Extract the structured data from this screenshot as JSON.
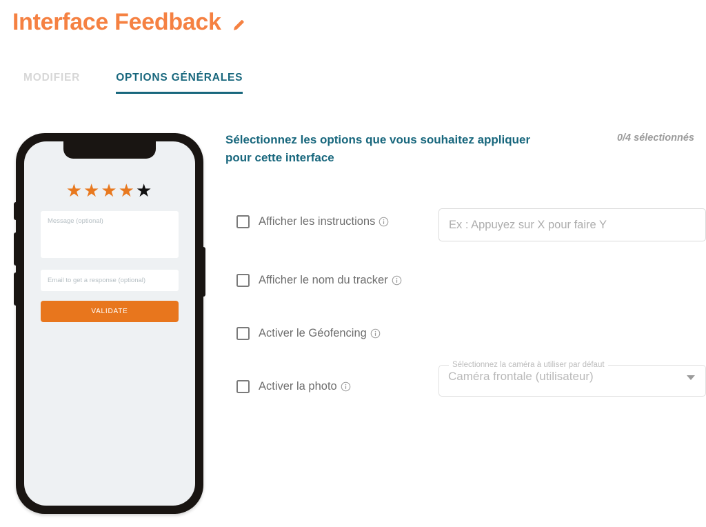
{
  "header": {
    "title": "Interface Feedback",
    "edit_icon": "pencil-icon",
    "title_color": "#f58142"
  },
  "tabs": [
    {
      "label": "MODIFIER",
      "active": false
    },
    {
      "label": "OPTIONS GÉNÉRALES",
      "active": true
    }
  ],
  "tab_active_color": "#18677d",
  "tab_inactive_color": "#d7d7d7",
  "phone_preview": {
    "rating": {
      "total": 5,
      "filled": 4,
      "filled_color": "#e8791f",
      "empty_color": "#111111",
      "glyph": "★"
    },
    "message_placeholder": "Message (optional)",
    "email_placeholder": "Email to get a response (optional)",
    "validate_label": "VALIDATE",
    "validate_color": "#e8761d",
    "screen_background": "#eef1f3",
    "frame_color": "#191512"
  },
  "panel": {
    "heading": "Sélectionnez les options que vous souhaitez appliquer pour cette interface",
    "heading_color": "#18677d",
    "counter": "0/4 sélectionnés",
    "options": [
      {
        "label": "Afficher les instructions",
        "info_icon": "info-icon",
        "checked": false,
        "input": {
          "placeholder": "Ex : Appuyez sur X pour faire Y",
          "value": ""
        }
      },
      {
        "label": "Afficher le nom du tracker",
        "info_icon": "info-icon",
        "checked": false
      },
      {
        "label": "Activer le Géofencing",
        "info_icon": "info-icon",
        "checked": false
      },
      {
        "label": "Activer la photo",
        "info_icon": "info-icon",
        "checked": false,
        "select": {
          "legend": "Sélectionnez la caméra à utiliser par défaut",
          "value": "Caméra frontale (utilisateur)",
          "arrow_icon": "chevron-down-icon"
        }
      }
    ]
  }
}
